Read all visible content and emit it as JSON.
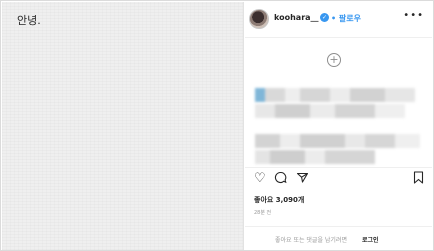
{
  "post": {
    "image_caption": "안녕."
  },
  "header": {
    "username": "koohara__",
    "verified_mark": "✓",
    "follow_label": "• 팔로우",
    "more_glyph": "•••"
  },
  "content": {
    "add_glyph": "+"
  },
  "actions": {
    "like_icon": "heart-icon",
    "comment_icon": "comment-icon",
    "share_icon": "share-icon",
    "save_icon": "bookmark-icon"
  },
  "stats": {
    "likes_text": "좋아요 3,090개",
    "time_text": "28분 전"
  },
  "comment_bar": {
    "prompt": "좋아요 또는 댓글을 남기려면",
    "login_label": "로그인"
  }
}
